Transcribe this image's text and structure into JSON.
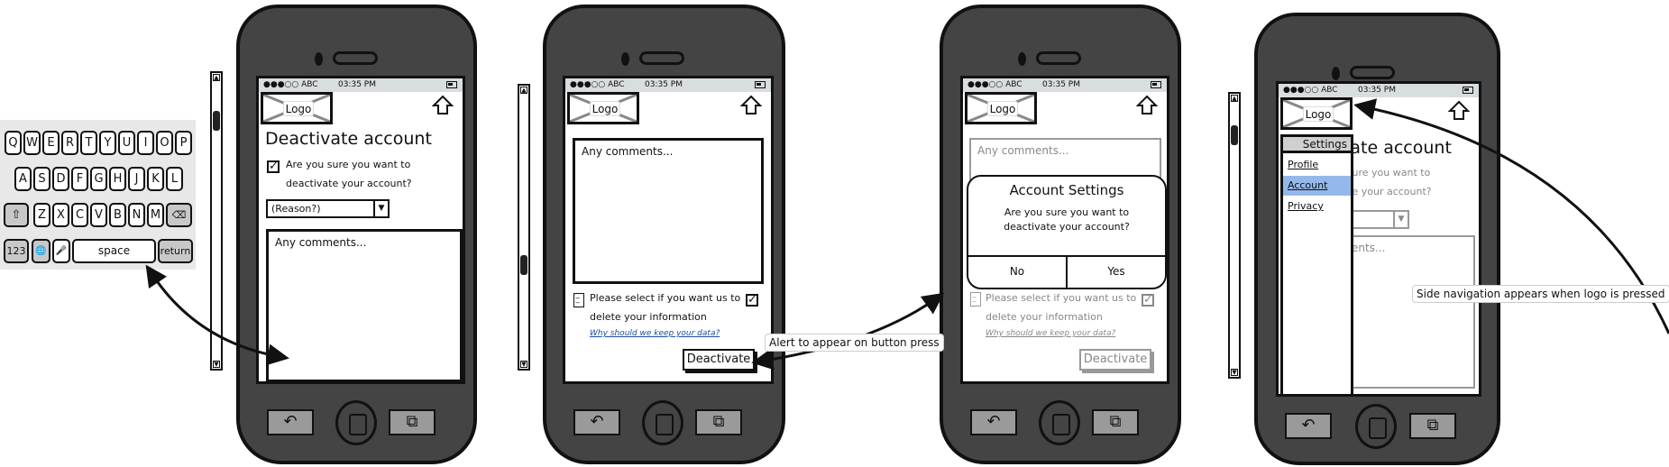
{
  "status": {
    "carrier": "●●●○○ ABC",
    "time": "03:35 PM"
  },
  "logo": "Logo",
  "keyboard": {
    "row1": [
      "Q",
      "W",
      "E",
      "R",
      "T",
      "Y",
      "U",
      "I",
      "O",
      "P"
    ],
    "row2": [
      "A",
      "S",
      "D",
      "F",
      "G",
      "H",
      "J",
      "K",
      "L"
    ],
    "row3": [
      "Z",
      "X",
      "C",
      "V",
      "B",
      "N",
      "M"
    ],
    "shift": "⇧",
    "backspace": "⌫",
    "numbers": "123",
    "globe": "🌐",
    "mic": "🎤",
    "space": "space",
    "return": "return"
  },
  "screen1": {
    "title": "Deactivate account",
    "confirm_label": "Are you sure you want to deactivate your account?",
    "reason_select": "(Reason?)",
    "comments_placeholder": "Any comments..."
  },
  "screen2": {
    "comments_placeholder": "Any comments...",
    "delete_label": "Please select if you want us to delete your information",
    "why_link": "Why should we keep your data?",
    "deactivate_button": "Deactivate"
  },
  "screen3": {
    "dialog_title": "Account Settings",
    "dialog_message": "Are you sure you want to deactivate your account?",
    "no_button": "No",
    "yes_button": "Yes"
  },
  "side_nav": {
    "header": "Settings",
    "items": [
      "Profile",
      "Account",
      "Privacy"
    ],
    "selected": "Account",
    "selected_color": "#94b8ea"
  },
  "annotations": {
    "alert": "Alert to appear on button press",
    "side_nav": "Side navigation appears when logo is pressed"
  }
}
